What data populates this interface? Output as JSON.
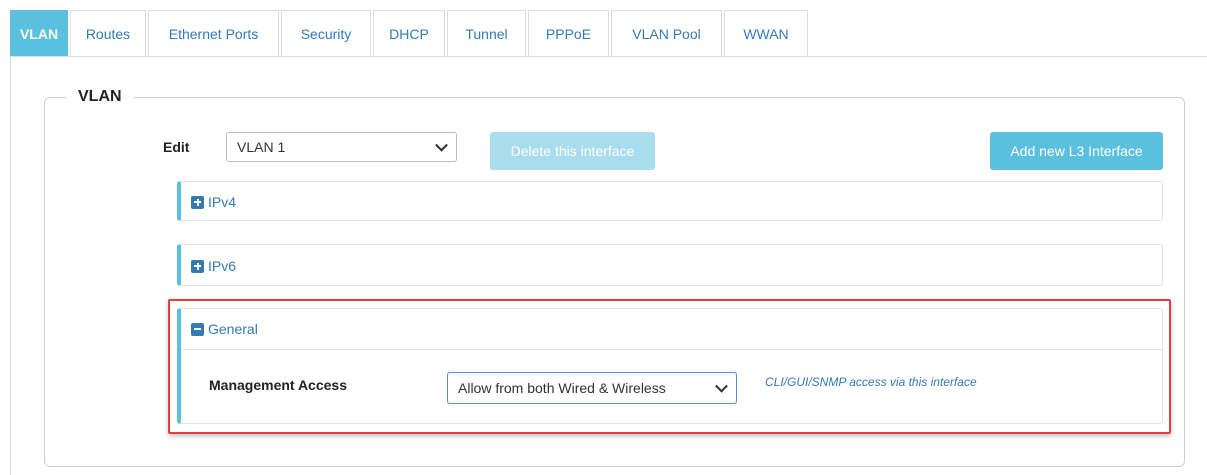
{
  "tabs": [
    {
      "label": "VLAN",
      "active": true
    },
    {
      "label": "Routes"
    },
    {
      "label": "Ethernet Ports"
    },
    {
      "label": "Security"
    },
    {
      "label": "DHCP"
    },
    {
      "label": "Tunnel"
    },
    {
      "label": "PPPoE"
    },
    {
      "label": "VLAN Pool"
    },
    {
      "label": "WWAN"
    }
  ],
  "vlan_section": {
    "legend": "VLAN",
    "edit_label": "Edit",
    "edit_select_value": "VLAN 1",
    "delete_button": "Delete this interface",
    "add_button": "Add new L3 Interface",
    "panels": {
      "ipv4": {
        "title": "IPv4",
        "state": "collapsed"
      },
      "ipv6": {
        "title": "IPv6",
        "state": "collapsed"
      },
      "general": {
        "title": "General",
        "state": "expanded",
        "management_access_label": "Management Access",
        "management_access_value": "Allow from both Wired & Wireless",
        "hint": "CLI/GUI/SNMP access via this interface"
      }
    }
  },
  "colors": {
    "accent": "#5bc0de",
    "link": "#337ab7",
    "highlight": "#e04040",
    "disabled_button": "#a9dcec"
  }
}
